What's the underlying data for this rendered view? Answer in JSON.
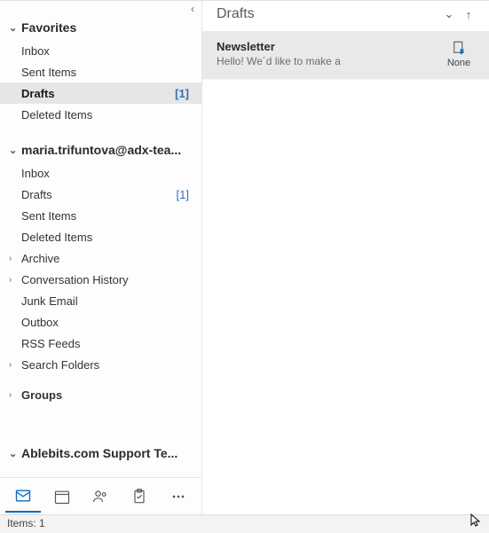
{
  "nav": {
    "favorites": {
      "title": "Favorites",
      "items": [
        {
          "label": "Inbox",
          "count": ""
        },
        {
          "label": "Sent Items",
          "count": ""
        },
        {
          "label": "Drafts",
          "count": "[1]",
          "selected": true
        },
        {
          "label": "Deleted Items",
          "count": ""
        }
      ]
    },
    "account": {
      "title": "maria.trifuntova@adx-tea...",
      "items": [
        {
          "label": "Inbox",
          "count": "",
          "chev": ""
        },
        {
          "label": "Drafts",
          "count": "[1]",
          "chev": ""
        },
        {
          "label": "Sent Items",
          "count": "",
          "chev": ""
        },
        {
          "label": "Deleted Items",
          "count": "",
          "chev": ""
        },
        {
          "label": "Archive",
          "count": "",
          "chev": "›"
        },
        {
          "label": "Conversation History",
          "count": "",
          "chev": "›"
        },
        {
          "label": "Junk Email",
          "count": "",
          "chev": ""
        },
        {
          "label": "Outbox",
          "count": "",
          "chev": ""
        },
        {
          "label": "RSS Feeds",
          "count": "",
          "chev": ""
        },
        {
          "label": "Search Folders",
          "count": "",
          "chev": "›"
        }
      ],
      "groups_label": "Groups"
    },
    "support": {
      "title": "Ablebits.com Support Te..."
    }
  },
  "list": {
    "header_title": "Drafts",
    "message": {
      "subject": "Newsletter",
      "preview": "Hello!  We´d like to make a",
      "date": "None"
    }
  },
  "status": {
    "items_label": "Items: 1"
  }
}
